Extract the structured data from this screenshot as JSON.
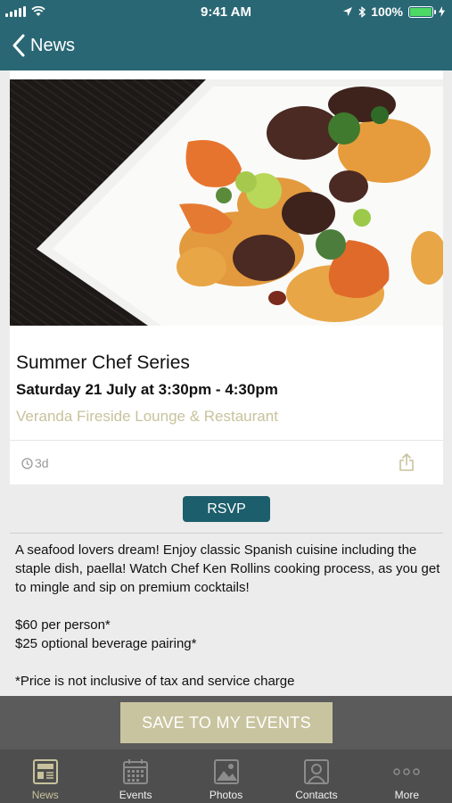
{
  "status_bar": {
    "time": "9:41 AM",
    "battery": "100%"
  },
  "nav": {
    "back_label": "News"
  },
  "event": {
    "title": "Summer Chef Series",
    "date": "Saturday 21 July at 3:30pm - 4:30pm",
    "venue": "Veranda Fireside Lounge & Restaurant",
    "age": "3d"
  },
  "rsvp_label": "RSVP",
  "description": {
    "intro": "A seafood lovers dream! Enjoy classic Spanish cuisine including the staple dish, paella! Watch Chef Ken Rollins cooking process, as you get to mingle and sip on premium cocktails!",
    "price_1": "$60 per person*",
    "price_2": "$25 optional beverage pairing*",
    "note": "*Price is not inclusive of tax and service charge"
  },
  "save_label": "SAVE TO MY EVENTS",
  "tabs": [
    {
      "label": "News",
      "icon": "newspaper-icon"
    },
    {
      "label": "Events",
      "icon": "calendar-icon"
    },
    {
      "label": "Photos",
      "icon": "photo-icon"
    },
    {
      "label": "Contacts",
      "icon": "contact-icon"
    },
    {
      "label": "More",
      "icon": "more-icon"
    }
  ],
  "colors": {
    "header": "#2a6775",
    "accent": "#c8c29c",
    "rsvp": "#1d5e6c"
  }
}
